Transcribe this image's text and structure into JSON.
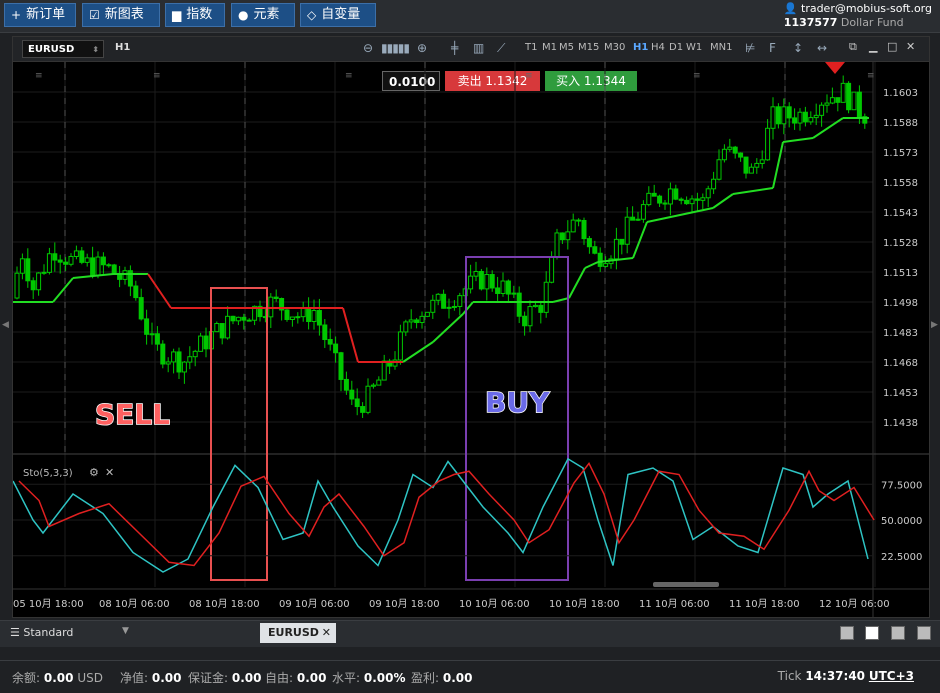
{
  "toolbar": {
    "new_order": "新订单",
    "new_chart": "新图表",
    "indicators": "指数",
    "elements": "元素",
    "variables": "自变量"
  },
  "account": {
    "user": "trader@mobius-soft.org",
    "id": "1137577",
    "fund": "Dollar Fund"
  },
  "chart": {
    "symbol": "EURUSD",
    "timeframe": "H1",
    "timeframes": [
      "T1",
      "M1",
      "M5",
      "M15",
      "M30",
      "H1",
      "H4",
      "D1",
      "W1",
      "MN1"
    ],
    "active_timeframe": "H1",
    "lot": "0.0100",
    "sell_label": "卖出",
    "sell_price": "1.1342",
    "buy_label": "买入",
    "buy_price": "1.1344",
    "indicator_label": "Sto(5,3,3)",
    "price_ticks": [
      "1.1603",
      "1.1588",
      "1.1573",
      "1.1558",
      "1.1543",
      "1.1528",
      "1.1513",
      "1.1498",
      "1.1483",
      "1.1468",
      "1.1453",
      "1.1438"
    ],
    "osc_ticks": [
      "77.5000",
      "50.0000",
      "22.5000"
    ],
    "time_ticks": [
      "05 10月 18:00",
      "08 10月 06:00",
      "08 10月 18:00",
      "09 10月 06:00",
      "09 10月 18:00",
      "10 10月 06:00",
      "10 10月 18:00",
      "11 10月 06:00",
      "11 10月 18:00",
      "12 10月 06:00"
    ],
    "annotations": {
      "sell": "SELL",
      "buy": "BUY"
    },
    "colors": {
      "up": "#00c800",
      "down": "#00c800",
      "trail": "#22dd22",
      "trail_down": "#e02020",
      "sto_k": "#2ec4c4",
      "sto_d": "#e02020",
      "sell_box": "#e85050",
      "buy_box": "#7a3fb0"
    }
  },
  "bottom": {
    "workspace": "Standard",
    "tab": "EURUSD"
  },
  "status": {
    "balance_label": "余额:",
    "balance": "0.00",
    "currency": "USD",
    "equity_label": "净值:",
    "equity": "0.00",
    "margin_label": "保证金:",
    "margin": "0.00",
    "free_label": "自由:",
    "free": "0.00",
    "level_label": "水平:",
    "level": "0.00%",
    "profit_label": "盈利:",
    "profit": "0.00",
    "tick_label": "Tick",
    "time": "14:37:40",
    "tz": "UTC+3"
  }
}
